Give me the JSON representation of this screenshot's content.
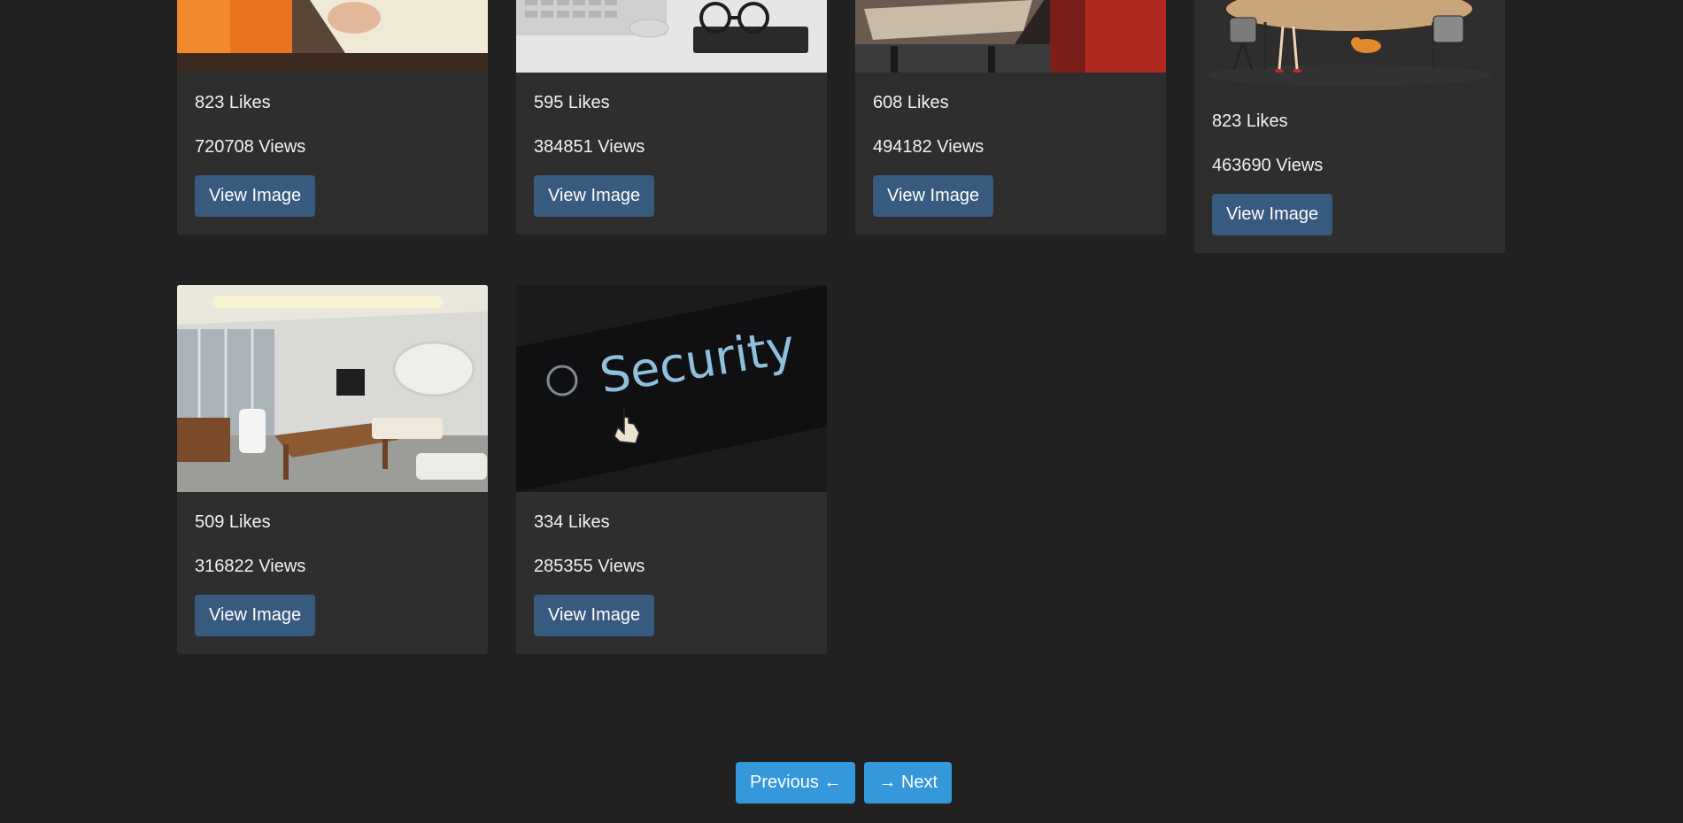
{
  "gallery": {
    "view_label": "View Image",
    "cards": [
      {
        "likes": "823 Likes",
        "views": "720708 Views",
        "thumb": "desk-notebook-image"
      },
      {
        "likes": "595 Likes",
        "views": "384851 Views",
        "thumb": "glasses-keyboard-image"
      },
      {
        "likes": "608 Likes",
        "views": "494182 Views",
        "thumb": "office-desk-image"
      },
      {
        "likes": "823 Likes",
        "views": "463690 Views",
        "thumb": "meeting-table-cartoon-image"
      },
      {
        "likes": "509 Likes",
        "views": "316822 Views",
        "thumb": "modern-office-image"
      },
      {
        "likes": "334 Likes",
        "views": "285355 Views",
        "thumb": "security-button-image"
      }
    ],
    "security_text": "Security"
  },
  "pagination": {
    "previous_label": "Previous ←",
    "next_label": "→ Next"
  },
  "colors": {
    "background": "#212121",
    "card": "#2e2e2e",
    "view_button": "#375a7f",
    "page_button": "#3498db"
  }
}
